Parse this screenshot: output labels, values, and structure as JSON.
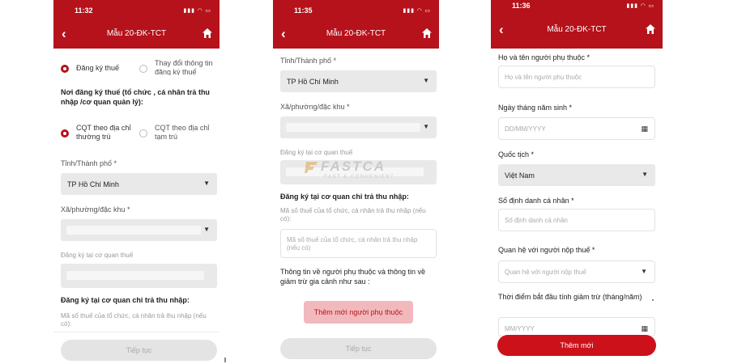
{
  "phones": [
    {
      "time": "11:32",
      "title": "Mẫu 20-ĐK-TCT",
      "radio_group1": [
        {
          "label": "Đăng ký thuế",
          "selected": true
        },
        {
          "label": "Thay đổi thông tin đăng ký thuế",
          "selected": false
        }
      ],
      "place_label": "Nơi đăng ký thuế (tổ chức , cá nhân trả thu nhập /cơ quan quản lý):",
      "radio_group2": [
        {
          "label": "CQT theo địa chỉ thường trú",
          "selected": true
        },
        {
          "label": "CQT theo địa chỉ tạm trú",
          "selected": false
        }
      ],
      "province_label": "Tỉnh/Thành phố *",
      "province_value": "TP Hồ Chí Minh",
      "ward_label": "Xã/phường/đặc khu *",
      "tax_office_label": "Đăng ký tại cơ quan thuế",
      "section_title": "Đăng ký tại cơ quan chi trả thu nhập:",
      "tax_code_label": "Mã số thuế của tổ chức, cá nhân trả thu nhập (nếu có):",
      "continue_label": "Tiếp tục"
    },
    {
      "time": "11:35",
      "title": "Mẫu 20-ĐK-TCT",
      "province_label": "Tỉnh/Thành phố *",
      "province_value": "TP Hồ Chí Minh",
      "ward_label": "Xã/phường/đặc khu *",
      "tax_office_label": "Đăng ký tại cơ quan thuế",
      "section_title": "Đăng ký tại cơ quan chi trả thu nhập:",
      "tax_code_label": "Mã số thuế của tổ chức, cá nhân trả thu nhập (nếu có):",
      "tax_code_placeholder": "Mã số thuế của tổ chức, cá nhân trả thu nhập (nếu có)",
      "dependents_info": "Thông tin về người phụ thuộc và thông tin về giảm trừ gia cảnh như sau :",
      "add_dependent_label": "Thêm mới người phụ thuộc",
      "continue_label": "Tiếp tục"
    },
    {
      "time": "11:36",
      "title": "Mẫu 20-ĐK-TCT",
      "name_label": "Họ và tên người phụ thuộc *",
      "name_placeholder": "Họ và tên người phụ thuộc",
      "dob_label": "Ngày tháng năm sinh *",
      "dob_placeholder": "DD/MM/YYYY",
      "nationality_label": "Quốc tịch *",
      "nationality_value": "Việt Nam",
      "id_label": "Số định danh cá nhân *",
      "id_placeholder": "Số định danh cá nhân",
      "relation_label": "Quan hệ với người nộp thuế *",
      "relation_placeholder": "Quan hệ với người nộp thuế",
      "start_label": "Thời điểm bắt đầu tính giảm trừ (tháng/năm)",
      "start_placeholder": "MM/YYYY",
      "add_new_label": "Thêm mới"
    }
  ],
  "watermark": {
    "brand": "FASTCA",
    "tagline": "FAST & CONVENIENT"
  },
  "colors": {
    "brand_red": "#b5121b",
    "button_red": "#cc111a",
    "pink": "#f2b9bc"
  }
}
